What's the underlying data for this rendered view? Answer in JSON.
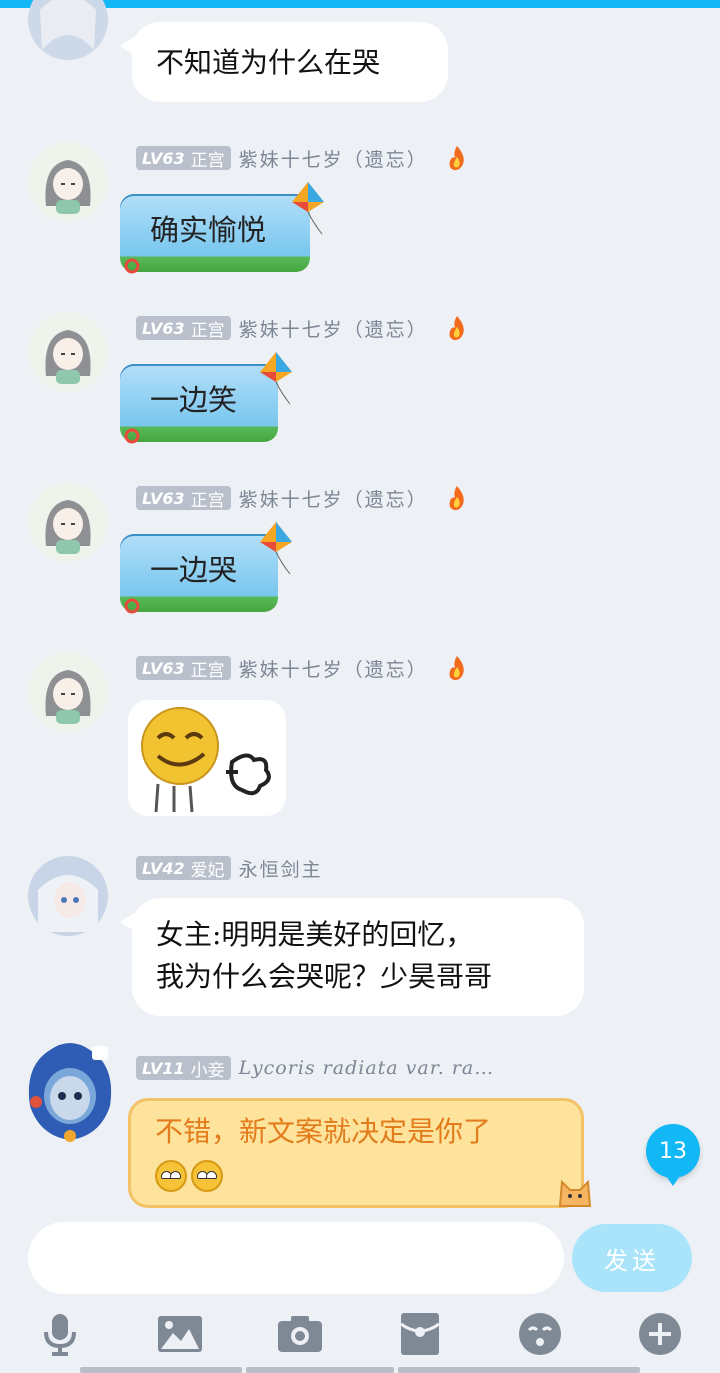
{
  "accent_color": "#12b7f5",
  "messages": [
    {
      "id": "m0",
      "text": "不知道为什么在哭"
    },
    {
      "id": "m1",
      "level": "LV63",
      "rank": "正宫",
      "nick": "紫妹十七岁（遗忘）",
      "text": "确实愉悦"
    },
    {
      "id": "m2",
      "level": "LV63",
      "rank": "正宫",
      "nick": "紫妹十七岁（遗忘）",
      "text": "一边笑"
    },
    {
      "id": "m3",
      "level": "LV63",
      "rank": "正宫",
      "nick": "紫妹十七岁（遗忘）",
      "text": "一边哭"
    },
    {
      "id": "m4",
      "level": "LV63",
      "rank": "正宫",
      "nick": "紫妹十七岁（遗忘）",
      "sticker": "smirk-face-sticker"
    },
    {
      "id": "m5",
      "level": "LV42",
      "rank": "爱妃",
      "nick": "永恒剑主",
      "text_line1": "女主:明明是美好的回忆，",
      "text_line2": "我为什么会哭呢？少昊哥哥"
    },
    {
      "id": "m6",
      "level": "LV11",
      "rank": "小妾",
      "nick": "Lycoris radiata var. ra…",
      "text": "不错，新文案就决定是你了"
    }
  ],
  "unread_badge": "13",
  "composer": {
    "placeholder": "",
    "send_label": "发送"
  },
  "toolbar_icons": [
    "microphone-icon",
    "image-icon",
    "camera-icon",
    "red-packet-icon",
    "emoji-icon",
    "plus-icon"
  ]
}
